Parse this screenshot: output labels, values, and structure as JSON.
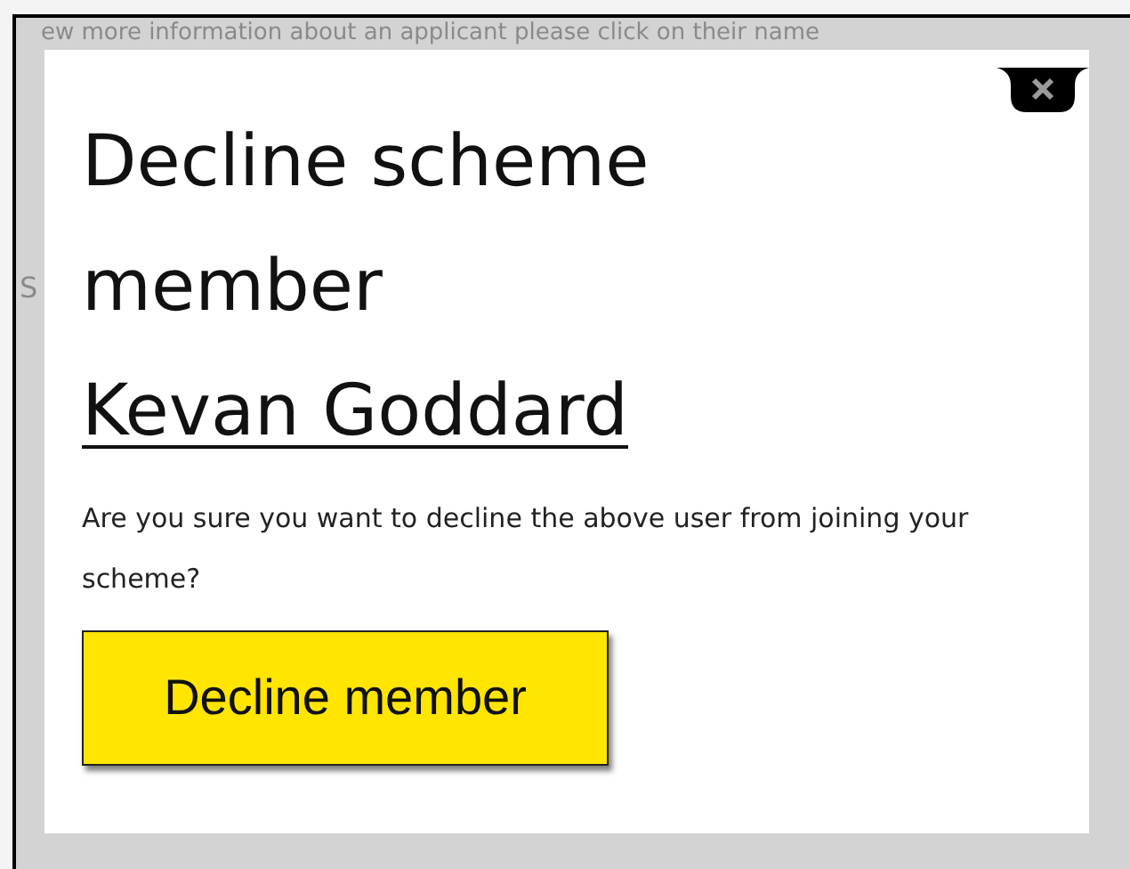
{
  "background_page": {
    "intro_text": "ew more information about an applicant please click on their name",
    "left_fragment": "S"
  },
  "modal": {
    "title": "Decline scheme member",
    "member_name": "Kevan Goddard",
    "message": "Are you sure you want to decline the above user from joining your scheme?",
    "button": "Decline member"
  }
}
